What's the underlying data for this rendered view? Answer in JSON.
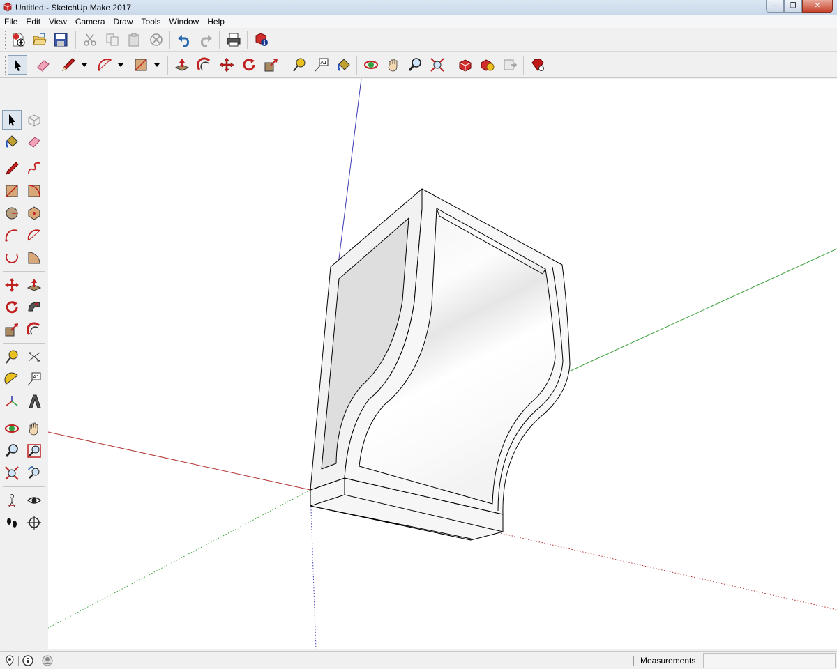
{
  "window": {
    "title": "Untitled - SketchUp Make 2017",
    "min_glyph": "—",
    "max_glyph": "❐",
    "close_glyph": "✕"
  },
  "menu": [
    "File",
    "Edit",
    "View",
    "Camera",
    "Draw",
    "Tools",
    "Window",
    "Help"
  ],
  "toolbar_standard": [
    "new-icon",
    "open-icon",
    "save-icon",
    "cut-icon",
    "copy-icon",
    "paste-icon",
    "erase-icon",
    "undo-icon",
    "redo-icon",
    "print-icon",
    "model-info-icon"
  ],
  "toolbar_getting_started": [
    "select-icon",
    "eraser-icon",
    "pencil-icon",
    "arc-icon",
    "rectangle-icon",
    "push-pull-icon",
    "offset-icon",
    "move-icon",
    "rotate-icon",
    "scale-icon",
    "tape-measure-icon",
    "text-icon",
    "paint-bucket-icon",
    "orbit-icon",
    "pan-icon",
    "zoom-icon",
    "zoom-extents-icon",
    "3d-warehouse-icon",
    "extension-warehouse-icon",
    "send-to-layout-icon",
    "extension-manager-icon"
  ],
  "text_tool_label": "A1",
  "palette": [
    "select-icon",
    "make-component-icon",
    "paint-bucket-icon",
    "eraser-icon",
    "line-icon",
    "freehand-icon",
    "rectangle-icon",
    "rotated-rectangle-icon",
    "circle-icon",
    "polygon-icon",
    "arc-icon",
    "two-point-arc-icon",
    "three-point-arc-icon",
    "pie-icon",
    "move-icon",
    "push-pull-icon",
    "rotate-icon",
    "follow-me-icon",
    "scale-icon",
    "offset-icon",
    "tape-measure-icon",
    "dimension-icon",
    "protractor-icon",
    "text-icon",
    "axes-icon",
    "3d-text-icon",
    "orbit-icon",
    "pan-icon",
    "zoom-icon",
    "zoom-window-icon",
    "zoom-extents-icon",
    "previous-view-icon",
    "position-camera-icon",
    "look-around-icon",
    "walk-icon",
    "section-plane-icon"
  ],
  "colors": {
    "axis_red": "#b03030",
    "axis_green": "#3aa03a",
    "axis_blue": "#3a3ab0",
    "face_light": "#fafafa",
    "face_shade": "#e4e4e4",
    "edge": "#000000"
  },
  "status": {
    "measurements_label": "Measurements",
    "measurements_value": ""
  }
}
